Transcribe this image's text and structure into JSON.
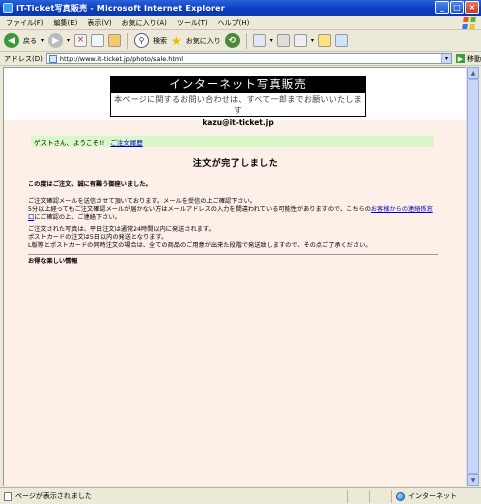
{
  "window": {
    "title": "IT-Ticket写真販売 - Microsoft Internet Explorer",
    "min": "_",
    "max": "□",
    "close": "×"
  },
  "menu": [
    "ファイル(F)",
    "編集(E)",
    "表示(V)",
    "お気に入り(A)",
    "ツール(T)",
    "ヘルプ(H)"
  ],
  "toolbar": {
    "back": "戻る",
    "search": "検索",
    "favorites": "お気に入り"
  },
  "address": {
    "label": "アドレス(D)",
    "url": "http://www.it-ticket.jp/photo/sale.html",
    "go": "移動"
  },
  "page": {
    "banner_title": "インターネット写真販売",
    "banner_notice": "本ページに関するお問い合わせは、すべて一郎までお願いいたします",
    "banner_email": "kazu@it-ticket.jp",
    "greeting": "ゲストさん、ようこそ!!",
    "order_history_link": "ご注文履歴",
    "heading": "注文が完了しました",
    "thanks": "この度はご注文、誠に有難う御座いました。",
    "p1_line1": "ご注文確認メールを送信させて頂いております。メールを受信の上ご確認下さい。",
    "p1_line2_a": "5分以上経ってもご注文確認メールが届かない方はメールアドレスの入力を間違われている可能性がありますので、こちらの",
    "p1_link": "お客様からの連絡係窓口",
    "p1_line2_b": "にご確認の上、ご連絡下さい。",
    "p2_line1": "ご注文された写真は、平日注文は通常24時間以内に発送されます。",
    "p2_line2": "ポストカードの注文は5日以内の発送となります。",
    "p2_line3": "L版等とポストカードの同時注文の場合は、全ての商品のご用意が出来た段階で発送致しますので、その点ご了承ください。",
    "info_heading": "お得な楽しい情報"
  },
  "status": {
    "left": "ページが表示されました",
    "zone": "インターネット"
  },
  "colors": {
    "titlebar": "#0a3bbf",
    "banner_bg": "#000000",
    "greeting_bg": "#d8f8c8",
    "content_bg": "#fdf0e8",
    "link": "#0000cc"
  }
}
